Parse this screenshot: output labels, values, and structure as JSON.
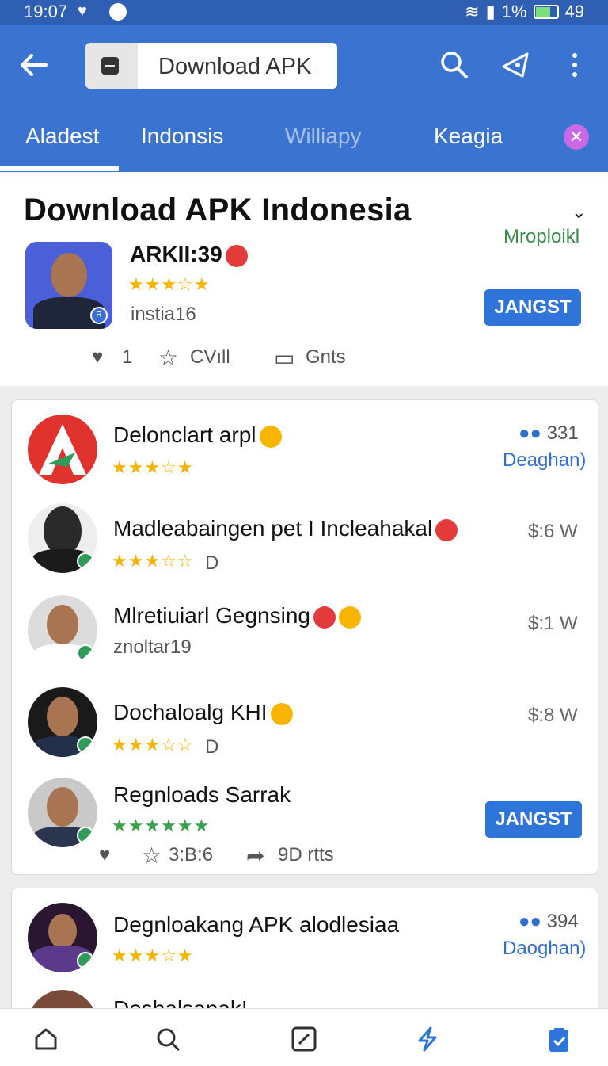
{
  "status": {
    "time": "19:07",
    "battery": "1%",
    "number": "49"
  },
  "appbar": {
    "search_value": "Download APK",
    "tabs": [
      "Aladest",
      "Indonsis",
      "Williapy",
      "Keagia"
    ]
  },
  "hero": {
    "title": "Download APK Indonesia",
    "sub": "Mroploikl",
    "app_name": "ARKII:39",
    "stars": "★★★☆★",
    "meta": "instia16",
    "install": "JANGST",
    "likes": "1",
    "fav": "CVıll",
    "share": "Gnts"
  },
  "card1": {
    "items": [
      {
        "title": "Delonclart arpl",
        "stars": "★★★☆★",
        "count": "331",
        "count_sub": "Deaghan)"
      },
      {
        "title": "Madleabaingen pet I Incleahakal",
        "stars": "★★★☆☆",
        "tag": "D",
        "price": "$:6  W"
      },
      {
        "title": "Mlretiuiarl Gegnsing",
        "sub": "znoltar19",
        "price": "$:1  W"
      },
      {
        "title": "Dochaloalg KHI",
        "stars": "★★★☆☆",
        "tag": "D",
        "price": "$:8  W"
      },
      {
        "title": "Regnloads Sarrak",
        "stars": "★★★★★★",
        "install": "JANGST",
        "fav": "3:B:6",
        "share": "9D rtts"
      }
    ]
  },
  "card2": {
    "items": [
      {
        "title": "Degnloakang APK alodlesiaa",
        "stars": "★★★☆★",
        "count": "394",
        "count_sub": "Daoghan)"
      },
      {
        "title": "Deshalsanak!"
      }
    ]
  },
  "colors": {
    "appbar": "#3b73d0",
    "accent": "#2f74d8",
    "green": "#3b8b4a"
  }
}
